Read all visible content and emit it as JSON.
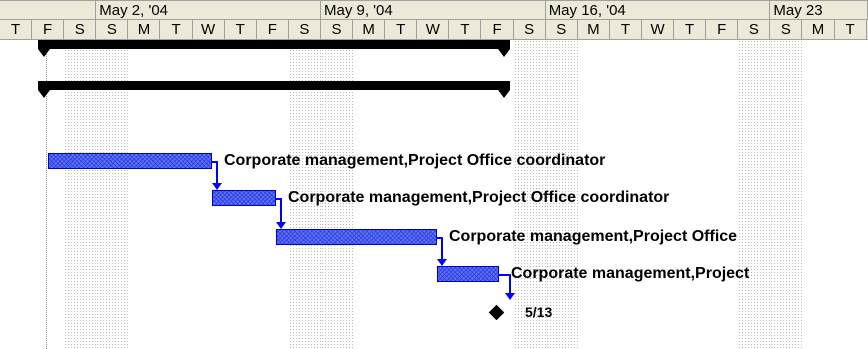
{
  "timescale": {
    "week_labels": [
      "May 2, '04",
      "May 9, '04",
      "May 16, '04",
      "May 23"
    ],
    "day_letters": [
      "T",
      "F",
      "S",
      "S",
      "M",
      "T",
      "W",
      "T",
      "F",
      "S",
      "S",
      "M",
      "T",
      "W",
      "T",
      "F",
      "S",
      "S",
      "M",
      "T",
      "W",
      "T",
      "F",
      "S",
      "S",
      "M",
      "T"
    ],
    "weekend_day_indexes": [
      2,
      3,
      9,
      10,
      16,
      17,
      23,
      24
    ]
  },
  "summary_tasks": [
    {
      "name": "summary-task-1"
    },
    {
      "name": "summary-task-2"
    }
  ],
  "tasks": [
    {
      "resource_label": "Corporate management,Project Office coordinator"
    },
    {
      "resource_label": "Corporate management,Project Office coordinator"
    },
    {
      "resource_label": "Corporate management,Project Office"
    },
    {
      "resource_label": "Corporate management,Project"
    }
  ],
  "milestone": {
    "date_label": "5/13"
  },
  "colors": {
    "task_bar": "#5c74ff",
    "task_bar_border": "#0000c8",
    "link_line": "#0000ff",
    "summary_bar": "#000000",
    "header_background": "#ece9d8"
  }
}
